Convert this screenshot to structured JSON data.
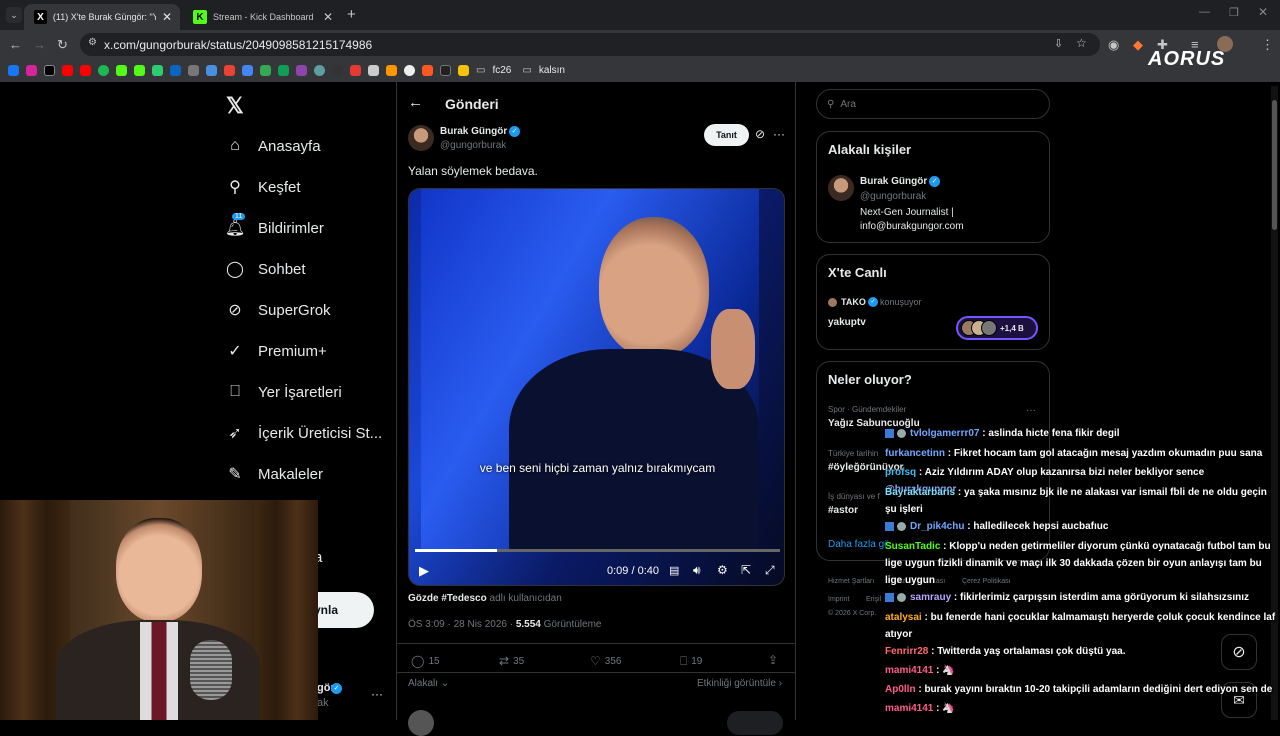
{
  "browser": {
    "tabs": [
      {
        "title": "(11) X'te Burak Güngör: \"Yalan s",
        "icon": "x-favicon"
      },
      {
        "title": "Stream - Kick Dashboard",
        "icon": "kick-favicon"
      }
    ],
    "url": "x.com/gungorburak/status/2049098581215174986",
    "bookmark_folders": [
      "fc26",
      "kalsın"
    ],
    "brand_overlay": "AORUS"
  },
  "nav": {
    "items": [
      {
        "label": "Anasayfa",
        "icon": "home-icon"
      },
      {
        "label": "Keşfet",
        "icon": "search-icon"
      },
      {
        "label": "Bildirimler",
        "icon": "bell-icon",
        "badge": "11"
      },
      {
        "label": "Sohbet",
        "icon": "chat-icon"
      },
      {
        "label": "SuperGrok",
        "icon": "grok-icon"
      },
      {
        "label": "Premium+",
        "icon": "verified-icon"
      },
      {
        "label": "Yer İşaretleri",
        "icon": "bookmark-icon"
      },
      {
        "label": "İçerik Üreticisi St...",
        "icon": "rocket-icon"
      },
      {
        "label": "Makaleler",
        "icon": "article-icon"
      }
    ],
    "partial_labels": [
      "a",
      "ıynla"
    ],
    "account_partial": {
      "name": "gör",
      "handle": "ak"
    }
  },
  "post": {
    "header_title": "Gönderi",
    "author_name": "Burak Güngör",
    "author_handle": "@gungorburak",
    "follow_label": "Tanıt",
    "text": "Yalan söylemek bedava.",
    "video_caption": "ve ben seni hiçbi zaman yalnız bırakmıycam",
    "video_time": "0:09 / 0:40",
    "video_progress": 0.225,
    "featured_prefix": "Gözde #Tedesco",
    "featured_suffix": "adlı kullanıcıdan",
    "time": "ÖS 3:09 · 28 Nis 2026 ·",
    "views_count": "5.554",
    "views_label": "Görüntüleme",
    "replies": "15",
    "reposts": "35",
    "likes": "356",
    "bookmarks": "19",
    "relevant_label": "Alakalı",
    "activity_label": "Etkinliği görüntüle"
  },
  "sidebar": {
    "search_placeholder": "Ara",
    "relevant_title": "Alakalı kişiler",
    "person_name": "Burak Güngör",
    "person_handle": "@gungorburak",
    "person_bio_1": "Next-Gen Journalist |",
    "person_bio_2": "info@burakgungor.com",
    "live_title": "X'te Canlı",
    "live_host": "TAKO",
    "live_status": "konuşuyor",
    "live_topic": "yakuptv",
    "live_count": "+1,4 B",
    "trends_title": "Neler oluyor?",
    "trend1_cat": "Spor · Gündemdekiler",
    "trend1_name": "Yağız Sabuncuoğlu",
    "trend2_cat": "Türkiye tarihin",
    "trend2_name": "#öyleğörünüyor",
    "trend3_cat": "İş dünyası ve f",
    "trend3_name": "#astor",
    "more_label": "Daha fazla gö",
    "footer_1": "Hizmet Şartları",
    "footer_2": "Gizlilik Politikası",
    "footer_3": "Çerez Politikası",
    "footer_4": "Imprint",
    "footer_5": "Erişil",
    "footer_6": "© 2026 X Corp."
  },
  "chat": [
    {
      "user": "tvlolgamerrr07",
      "color": "#6fa8ff",
      "msg": "aslinda hicte fena fikir degil",
      "badges": true
    },
    {
      "user": "furkancetinn",
      "color": "#6fa8ff",
      "msg": "Fikret hocam tam gol atacağın mesaj yazdım okumadın puu sana"
    },
    {
      "user": "profsq",
      "color": "#3dbdf0",
      "msg": "Aziz Yıldırım ADAY olup kazanırsa bizi neler bekliyor sence",
      "mention": "@burakgungor"
    },
    {
      "user": "Bayraktarbaris",
      "color": "#7ee0ff",
      "msg": "ya şaka mısınız bjk ile ne alakası var ismail fbli de ne oldu geçin şu işleri"
    },
    {
      "user": "Dr_pik4chu",
      "color": "#6fa8ff",
      "msg": "halledilecek hepsi aucbafıuc",
      "badges": true
    },
    {
      "user": "SusanTadic",
      "color": "#53fc18",
      "msg": "Klopp'u neden getirmeliler diyorum çünkü oynatacağı futbol tam bu lige uygun fizikli dinamik ve maçı ilk 30 dakkada çözen bir oyun anlayışı tam bu lige uygun"
    },
    {
      "user": "samrauy",
      "color": "#b8a4ff",
      "msg": "fikirlerimiz çarpışsın isterdim ama görüyorum ki silahsızsınız",
      "badges": true
    },
    {
      "user": "atalysai",
      "color": "#ffb020",
      "msg": "bu fenerde hani çocuklar kalmamaıştı heryerde çoluk çocuk kendince laf atıyor"
    },
    {
      "user": "Fenrirr28",
      "color": "#ff6b6b",
      "msg": "Twitterda yaş ortalaması çok düştü yaa."
    },
    {
      "user": "mami4141",
      "color": "#ff5c8a",
      "msg": "🦄"
    },
    {
      "user": "Ap0lln",
      "color": "#ff5c8a",
      "msg": "burak yayını bıraktın 10-20 takipçili adamların dediğini dert ediyon sen de"
    },
    {
      "user": "mami4141",
      "color": "#ff5c8a",
      "msg": "🦄"
    }
  ]
}
